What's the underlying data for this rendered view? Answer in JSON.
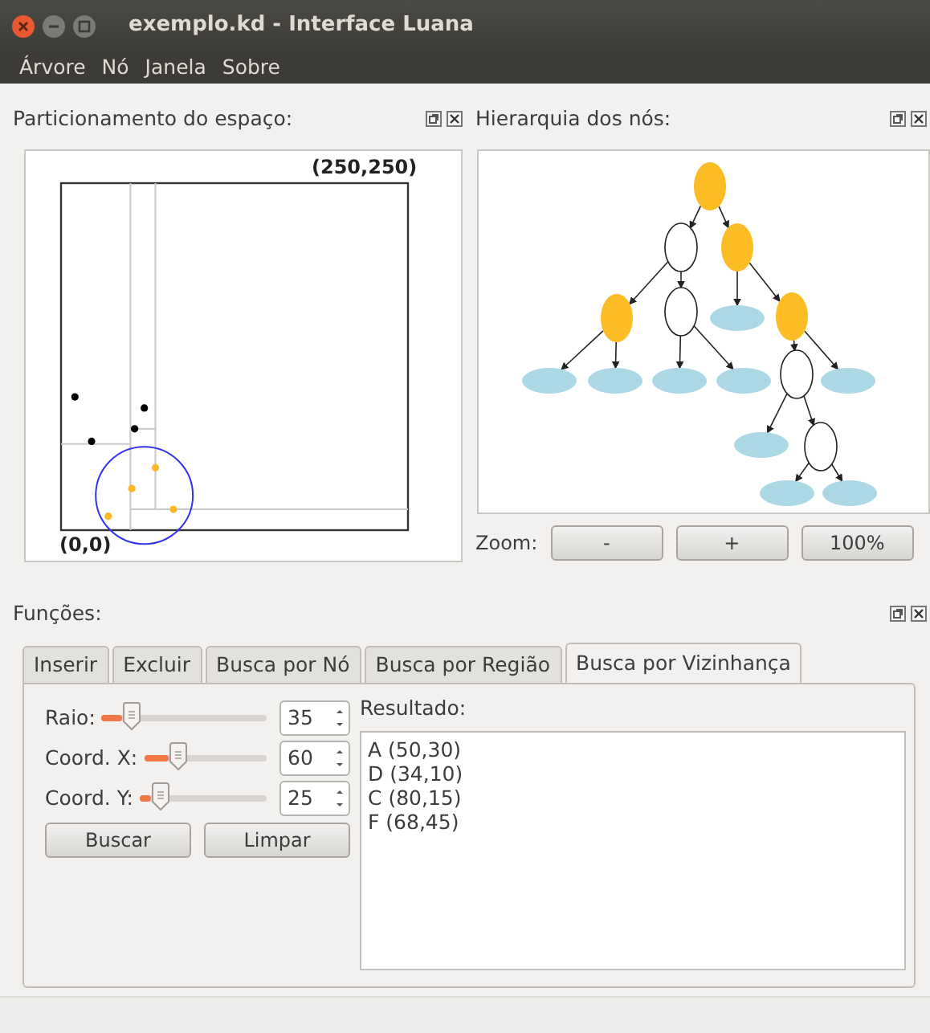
{
  "window": {
    "title": "exemplo.kd - Interface Luana"
  },
  "menu": [
    "Árvore",
    "Nó",
    "Janela",
    "Sobre"
  ],
  "partition": {
    "title": "Particionamento do espaço:",
    "max_label": "(250,250)",
    "origin_label": "(0,0)"
  },
  "hierarchy": {
    "title": "Hierarquia dos nós:",
    "zoom_label": "Zoom:",
    "zoom_buttons": [
      "-",
      "+",
      "100%"
    ]
  },
  "functions": {
    "title": "Funções:",
    "tabs": [
      {
        "label": "Inserir",
        "selected": false
      },
      {
        "label": "Excluir",
        "selected": false
      },
      {
        "label": "Busca por Nó",
        "selected": false
      },
      {
        "label": "Busca por Região",
        "selected": false
      },
      {
        "label": "Busca por Vizinhança",
        "selected": true
      }
    ],
    "fields": [
      {
        "label": "Raio:",
        "value": "35",
        "level": 0.14
      },
      {
        "label": "Coord. X:",
        "value": "60",
        "level": 0.24
      },
      {
        "label": "Coord. Y:",
        "value": "25",
        "level": 0.1
      }
    ],
    "buttons": [
      "Buscar",
      "Limpar"
    ],
    "result_label": "Resultado:",
    "results": [
      "A (50,30)",
      "D (34,10)",
      "C (80,15)",
      "F (68,45)"
    ]
  }
}
